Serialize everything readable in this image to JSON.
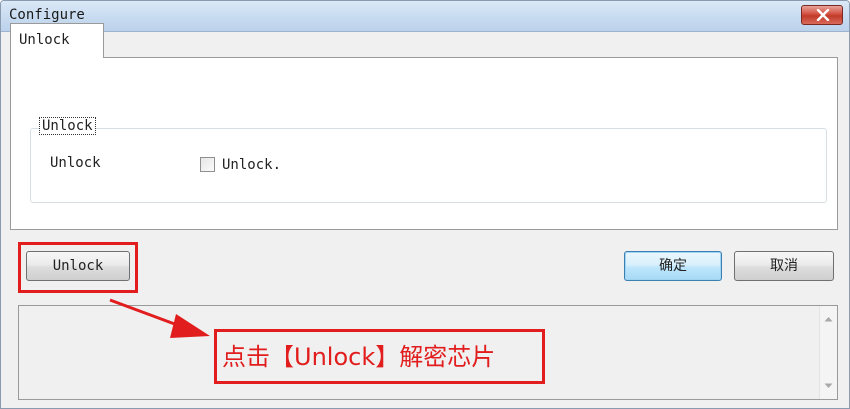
{
  "window": {
    "title": "Configure"
  },
  "tabs": [
    {
      "label": "Unlock"
    }
  ],
  "group": {
    "legend": "Unlock",
    "row_label": "Unlock",
    "checkbox_label": "Unlock.",
    "checkbox_checked": false
  },
  "buttons": {
    "unlock": "Unlock",
    "ok": "确定",
    "cancel": "取消"
  },
  "annotation": {
    "text": "点击【Unlock】解密芯片",
    "color": "#e21d1d"
  },
  "icons": {
    "close": "close-icon",
    "scroll_up": "scroll-up-arrow-icon",
    "scroll_down": "scroll-down-arrow-icon",
    "arrow": "red-pointer-arrow"
  }
}
